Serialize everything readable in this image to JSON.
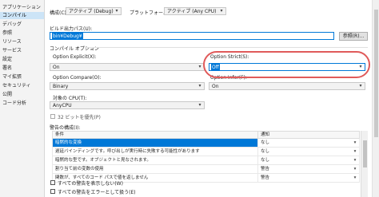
{
  "sidebar": {
    "items": [
      {
        "label": "アプリケーション",
        "active": false
      },
      {
        "label": "コンパイル",
        "active": true
      },
      {
        "label": "デバッグ",
        "active": false
      },
      {
        "label": "参照",
        "active": false
      },
      {
        "label": "リソース",
        "active": false
      },
      {
        "label": "サービス",
        "active": false
      },
      {
        "label": "設定",
        "active": false
      },
      {
        "label": "署名",
        "active": false
      },
      {
        "label": "マイ拡張",
        "active": false
      },
      {
        "label": "セキュリティ",
        "active": false
      },
      {
        "label": "公開",
        "active": false
      },
      {
        "label": "コード分析",
        "active": false
      }
    ]
  },
  "header": {
    "config_label": "構成(C):",
    "config_value": "アクティブ (Debug)",
    "platform_label": "プラットフォーム(M):",
    "platform_value": "アクティブ (Any CPU)"
  },
  "build_output": {
    "label": "ビルド出力パス(U):",
    "value": "bin¥Debug¥",
    "browse_label": "参照(R)..."
  },
  "compile_options": {
    "section_title": "コンパイル オプション",
    "option_explicit_label": "Option Explicit(X):",
    "option_explicit_value": "On",
    "option_strict_label": "Option Strict(S):",
    "option_strict_value": "Off",
    "option_compare_label": "Option Compare(O):",
    "option_compare_value": "Binary",
    "option_infer_label": "Option Infer(F):",
    "option_infer_value": "On",
    "target_cpu_label": "対象の CPU(T):",
    "target_cpu_value": "AnyCPU",
    "prefer32_label": "32 ビットを優先(P)"
  },
  "warnings": {
    "label": "警告の構成(I):",
    "columns": [
      "条件",
      "通知"
    ],
    "rows": [
      {
        "condition": "暗黙的な変換",
        "notify": "なし"
      },
      {
        "condition": "遅延バインディングです。呼び出しが実行時に失敗する可能性があります",
        "notify": "なし"
      },
      {
        "condition": "暗黙的な型です。オブジェクトと見なされます。",
        "notify": "なし"
      },
      {
        "condition": "割り当て前の変数の使用",
        "notify": "警告"
      },
      {
        "condition": "関数が、すべてのコード パスで値を返しません",
        "notify": "警告"
      }
    ]
  },
  "bottom_options": {
    "disable_all_warnings": "すべての警告を表示しない(W)",
    "treat_warnings_errors": "すべての警告をエラーとして扱う(E)"
  },
  "colors": {
    "accent": "#0078d7",
    "selected_sidebar": "#cce4f7",
    "highlight_row": "#0078d7",
    "annotation": "#e05a5a"
  }
}
